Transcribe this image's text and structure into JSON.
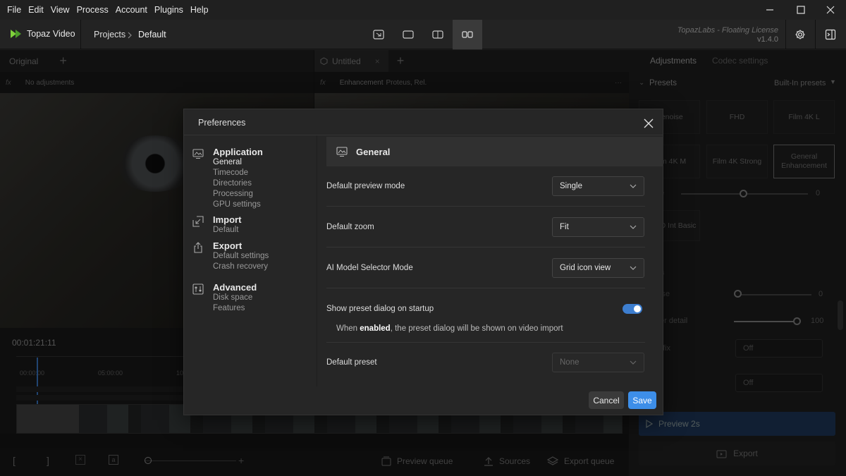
{
  "menubar": {
    "items": [
      "File",
      "Edit",
      "View",
      "Process",
      "Account",
      "Plugins",
      "Help"
    ]
  },
  "header": {
    "app_name": "Topaz Video",
    "breadcrumb": [
      "Projects",
      "Default"
    ],
    "license_line": "TopazLabs - Floating License",
    "version": "v1.4.0"
  },
  "left_pane": {
    "tab": "Original",
    "subtitle": "No adjustments"
  },
  "right_pane": {
    "tab": "Untitled",
    "subtitle": "Enhancement",
    "model": "Proteus, Rel.",
    "timecode": "00:01:21:11",
    "ticks": [
      "00:00:00",
      "05:00:00",
      "10"
    ]
  },
  "adjustments": {
    "tabs": [
      "Adjustments",
      "Codec settings"
    ],
    "presets_label": "Presets",
    "builtin_label": "Built-In presets",
    "presets": [
      "Denoise",
      "FHD",
      "Film 4K L",
      "Film 4K M",
      "Film 4K Strong",
      "General Enhancement",
      "DV HD Int Basic"
    ],
    "partial_labels": [
      "e",
      "a",
      "ise",
      "er detail",
      "fix"
    ],
    "values": [
      "0",
      "0",
      "100"
    ],
    "selects": [
      "Off",
      "Off"
    ],
    "preview_label": "Preview 2s",
    "export_label": "Export"
  },
  "bottom_bar": {
    "items": [
      "Preview queue",
      "Sources",
      "Export queue"
    ]
  },
  "dialog": {
    "title": "Preferences",
    "nav": [
      {
        "title": "Application",
        "items": [
          "General",
          "Timecode",
          "Directories",
          "Processing",
          "GPU settings"
        ]
      },
      {
        "title": "Import",
        "items": [
          "Default"
        ]
      },
      {
        "title": "Export",
        "items": [
          "Default settings",
          "Crash recovery"
        ]
      },
      {
        "title": "Advanced",
        "items": [
          "Disk space",
          "Features"
        ]
      }
    ],
    "section_title": "General",
    "settings": [
      {
        "label": "Default preview mode",
        "value": "Single"
      },
      {
        "label": "Default zoom",
        "value": "Fit"
      },
      {
        "label": "AI Model Selector Mode",
        "value": "Grid icon view"
      },
      {
        "label": "Show preset dialog on startup",
        "toggle": true
      },
      {
        "label": "Default preset",
        "value": "None"
      }
    ],
    "help": {
      "prefix": "When ",
      "bold": "enabled",
      "suffix": ", the preset dialog will be shown on video import"
    },
    "cancel_label": "Cancel",
    "save_label": "Save"
  },
  "colors": {
    "accent": "#3d8ee8",
    "toggle_on": "#3d7ecf",
    "brand_green": "#7fd13b"
  }
}
